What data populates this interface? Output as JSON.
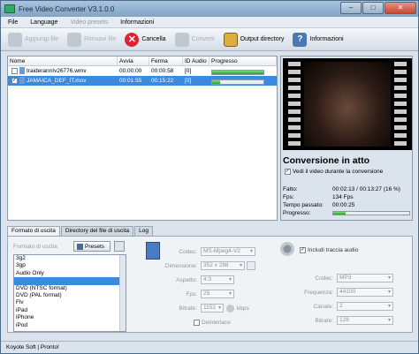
{
  "window": {
    "title": "Free Video Converter V3.1.0.0"
  },
  "menu": {
    "file": "File",
    "language": "Language",
    "presets": "Video presets",
    "info": "Informazioni"
  },
  "toolbar": {
    "add": "Aggiungi file",
    "remove": "Rimuovi file",
    "cancel": "Cancella",
    "convert": "Converti",
    "output_dir": "Output directory",
    "info": "Informazioni"
  },
  "filelist": {
    "columns": [
      "Nome",
      "Avvia",
      "Ferma",
      "ID Audio",
      "Progresso"
    ],
    "rows": [
      {
        "checked": "",
        "name": "traiderannIv26776.wmv",
        "start": "00:00:00",
        "stop": "00:00:58",
        "audio": "[0]",
        "progress": 1.0
      },
      {
        "checked": "✓",
        "name": "JAMAICA_DEF_IT.mov",
        "start": "00:01:55",
        "stop": "00:15:22",
        "audio": "[0]",
        "progress": 0.16
      }
    ]
  },
  "conversion": {
    "title": "Conversione in atto",
    "show_video_label": "Vedi il video durante la conversione",
    "done_label": "Fatto:",
    "done_value": "00:02:13 / 00:13:27  (16 %)",
    "fps_label": "Fps:",
    "fps_value": "134 Fps",
    "time_label": "Tempo passato:",
    "time_value": "00:00:25",
    "progress_label": "Progresso:",
    "progress": 0.16
  },
  "tabs": [
    "Formato di uscita",
    "Directory del file di uscita",
    "Log"
  ],
  "format": {
    "label": "Formato di uscita",
    "presets_label": "Presets",
    "items": [
      "3g2",
      "3gp",
      "Audio Only",
      "",
      "DVD (NTSC format)",
      "DVD (PAL format)",
      "Flv",
      "iPad",
      "iPhone",
      "iPod"
    ],
    "selected_index": 3
  },
  "video": {
    "codec_label": "Codec:",
    "codec": "MS-Mpeg4-V2",
    "size_label": "Dimensione:",
    "size": "352 x 288",
    "aspect_label": "Aspetto:",
    "aspect": "4:3",
    "fps_label": "Fps:",
    "fps": "25",
    "bitrate_label": "Bitrate:",
    "bitrate": "1152",
    "bitrate_unit": "kbps",
    "deinterlace_label": "Deinterlace"
  },
  "audio": {
    "include_label": "Includi traccia audio",
    "codec_label": "Codec:",
    "codec": "MP3",
    "freq_label": "Frequenza:",
    "freq": "44100",
    "channels_label": "Canale:",
    "channels": "2",
    "bitrate_label": "Bitrate:",
    "bitrate": "128"
  },
  "status": {
    "text": "Koyote Soft  |  Pronto!"
  }
}
